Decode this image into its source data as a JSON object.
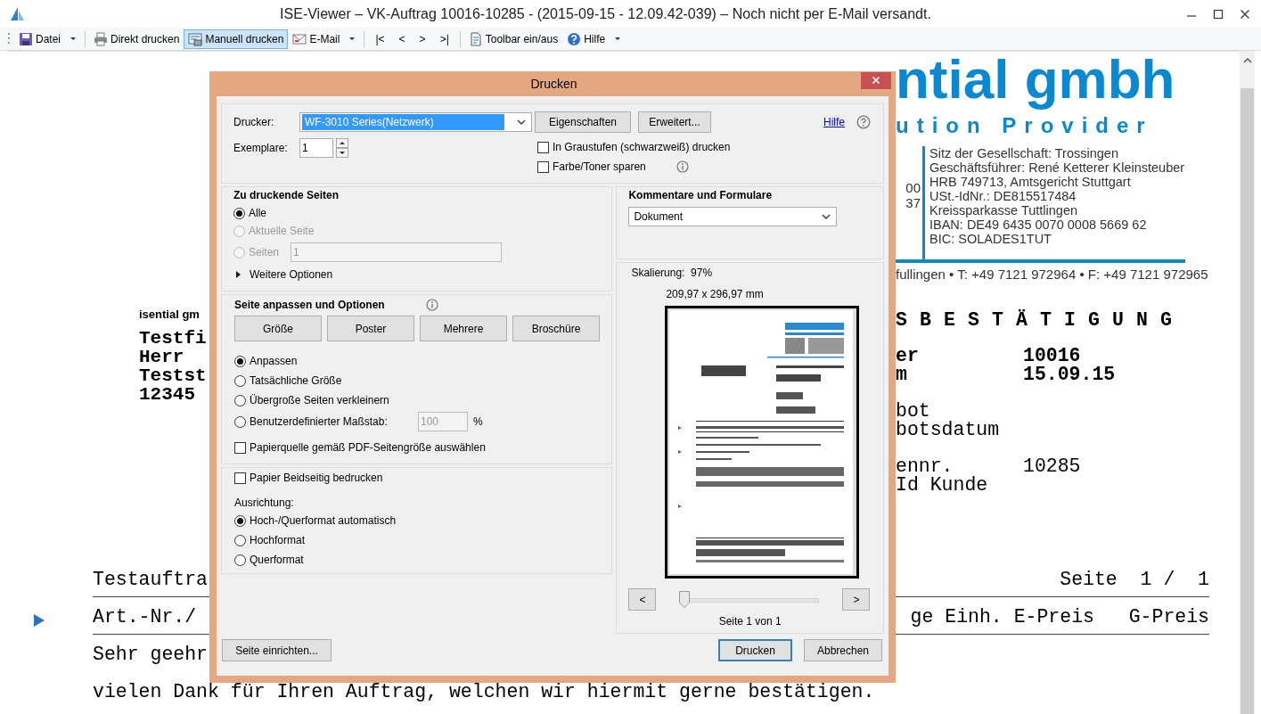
{
  "window": {
    "title": "ISE-Viewer – VK-Auftrag 10016-10285 - (2015-09-15 - 12.09.42-039) – Noch nicht per E-Mail versandt."
  },
  "toolbar_groups": [
    [
      {
        "kind": "button",
        "label": "Datei",
        "dropdown": true,
        "selected": false
      }
    ],
    [
      {
        "kind": "button",
        "label": "Direkt drucken",
        "dropdown": false,
        "selected": false
      },
      {
        "kind": "button",
        "label": "Manuell drucken",
        "dropdown": false,
        "selected": true
      },
      {
        "kind": "button",
        "label": "E-Mail",
        "dropdown": true,
        "selected": false
      }
    ],
    [
      {
        "kind": "nav",
        "label": "|<"
      },
      {
        "kind": "nav",
        "label": "<"
      },
      {
        "kind": "nav",
        "label": ">"
      },
      {
        "kind": "nav",
        "label": ">|"
      }
    ],
    [
      {
        "kind": "button",
        "label": "Toolbar ein/aus",
        "dropdown": false,
        "selected": false
      },
      {
        "kind": "button",
        "label": "Hilfe",
        "dropdown": true,
        "selected": false
      }
    ]
  ],
  "document": {
    "logo": "ntial gmbh",
    "tagline": "ution Provider",
    "contact_partial": [
      "00",
      "37"
    ],
    "company_info": [
      "Sitz der Gesellschaft: Trossingen",
      "Geschäftsführer: René Ketterer Kleinsteuber",
      "HRB 749713, Amtsgericht Stuttgart",
      "USt.-IdNr.: DE815517484",
      "Kreissparkasse Tuttlingen",
      "IBAN: DE49 6435 0070 0008 5669 62",
      "BIC: SOLADES1TUT"
    ],
    "address_line": "fullingen • T: +49 7121 972964 • F: +49 7121 972965",
    "sender_line": "isential gm",
    "recipient": [
      "Testfi",
      "Herr",
      "Testst",
      "12345"
    ],
    "heading": "S B E S T Ä T I G U N G",
    "field_groups": [
      {
        "bold": true,
        "rows": [
          {
            "label": "er",
            "value": "10016"
          },
          {
            "label": "m",
            "value": "15.09.15"
          }
        ]
      },
      {
        "bold": false,
        "rows": [
          {
            "label": "bot"
          },
          {
            "label": "botsdatum"
          }
        ]
      },
      {
        "bold": false,
        "rows": [
          {
            "label": "ennr.",
            "value": "10285"
          },
          {
            "label": "Id Kunde"
          }
        ]
      }
    ],
    "lines": [
      {
        "kind": "row",
        "left": "Testauftra",
        "right": "Seite  1 /  1"
      },
      {
        "kind": "rule"
      },
      {
        "kind": "row",
        "left": "Art.-Nr./",
        "right": "ge Einh. E-Preis   G-Preis",
        "marker": true
      },
      {
        "kind": "rule"
      },
      {
        "kind": "row",
        "left": "Sehr geehr"
      },
      {
        "kind": "blank"
      },
      {
        "kind": "row",
        "left": "vielen Dank für Ihren Auftrag, welchen wir hiermit gerne bestätigen."
      }
    ]
  },
  "dialog": {
    "title": "Drucken",
    "printer": {
      "label": "Drucker:",
      "value": "WF-3010 Series(Netzwerk)"
    },
    "properties_button": "Eigenschaften",
    "advanced_button": "Erweitert...",
    "help_link": "Hilfe",
    "copies": {
      "label": "Exemplare:",
      "value": "1"
    },
    "options": [
      {
        "label": "In Graustufen (schwarzweiß) drucken",
        "checked": false,
        "info": false
      },
      {
        "label": "Farbe/Toner sparen",
        "checked": false,
        "info": true
      }
    ],
    "pages": {
      "title": "Zu druckende Seiten",
      "choices": [
        {
          "label": "Alle",
          "selected": true,
          "disabled": false
        },
        {
          "label": "Aktuelle Seite",
          "selected": false,
          "disabled": true
        },
        {
          "label": "Seiten",
          "selected": false,
          "disabled": true,
          "range": "1"
        }
      ],
      "more": {
        "label": "Weitere Optionen",
        "expanded": false
      }
    },
    "sizing": {
      "title": "Seite anpassen und Optionen",
      "modes": [
        "Größe",
        "Poster",
        "Mehrere",
        "Broschüre"
      ],
      "choices": [
        {
          "label": "Anpassen",
          "selected": true
        },
        {
          "label": "Tatsächliche Größe",
          "selected": false
        },
        {
          "label": "Übergroße Seiten verkleinern",
          "selected": false
        },
        {
          "label": "Benutzerdefinierter Maßstab:",
          "selected": false,
          "scale": "100",
          "unit": "%"
        }
      ],
      "paper_source": {
        "label": "Papierquelle gemäß PDF-Seitengröße auswählen",
        "checked": false
      }
    },
    "duplex": {
      "label": "Papier Beidseitig bedrucken",
      "checked": false
    },
    "orientation": {
      "title": "Ausrichtung:",
      "choices": [
        {
          "label": "Hoch-/Querformat automatisch",
          "selected": true
        },
        {
          "label": "Hochformat",
          "selected": false
        },
        {
          "label": "Querformat",
          "selected": false
        }
      ]
    },
    "comments": {
      "title": "Kommentare und Formulare",
      "value": "Dokument"
    },
    "preview": {
      "scaling": "Skalierung:  97%",
      "size": "209,97 x 296,97 mm",
      "prev": "<",
      "next": ">",
      "level": 0,
      "page": "Seite 1 von 1"
    },
    "buttons": {
      "setup": "Seite einrichten...",
      "print": "Drucken",
      "cancel": "Abbrechen"
    }
  }
}
